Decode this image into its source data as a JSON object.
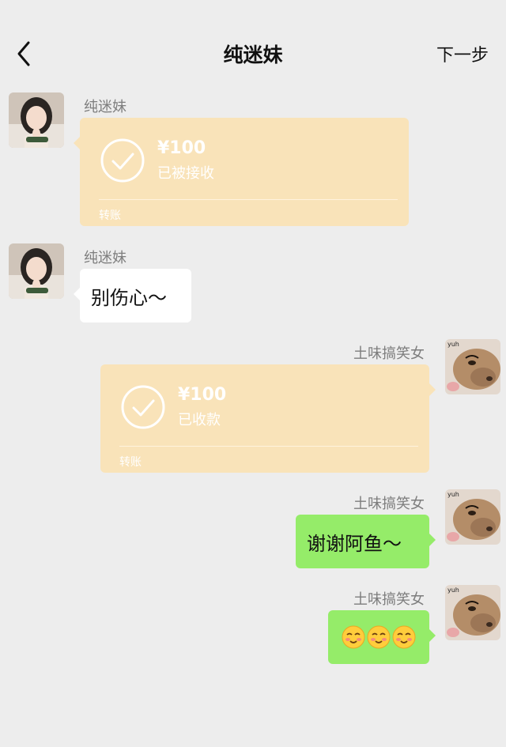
{
  "header": {
    "title": "纯迷妹",
    "next_label": "下一步",
    "back_icon": "chevron-left-icon"
  },
  "messages": {
    "m1": {
      "sender": "纯迷妹",
      "amount": "¥100",
      "status": "已被接收",
      "kind": "转账"
    },
    "m2": {
      "sender": "纯迷妹",
      "text": "别伤心～"
    },
    "m3": {
      "sender": "土味搞笑女",
      "amount": "¥100",
      "status": "已收款",
      "kind": "转账"
    },
    "m4": {
      "sender": "土味搞笑女",
      "text": "谢谢阿鱼～"
    },
    "m5": {
      "sender": "土味搞笑女",
      "emojis": [
        "blush-face-icon",
        "blush-face-icon",
        "blush-face-icon"
      ]
    }
  },
  "avatar_watermark": "yuh",
  "colors": {
    "background": "#ededed",
    "transfer": "#f9e3b9",
    "outgoing": "#95ec69",
    "incoming": "#ffffff"
  }
}
